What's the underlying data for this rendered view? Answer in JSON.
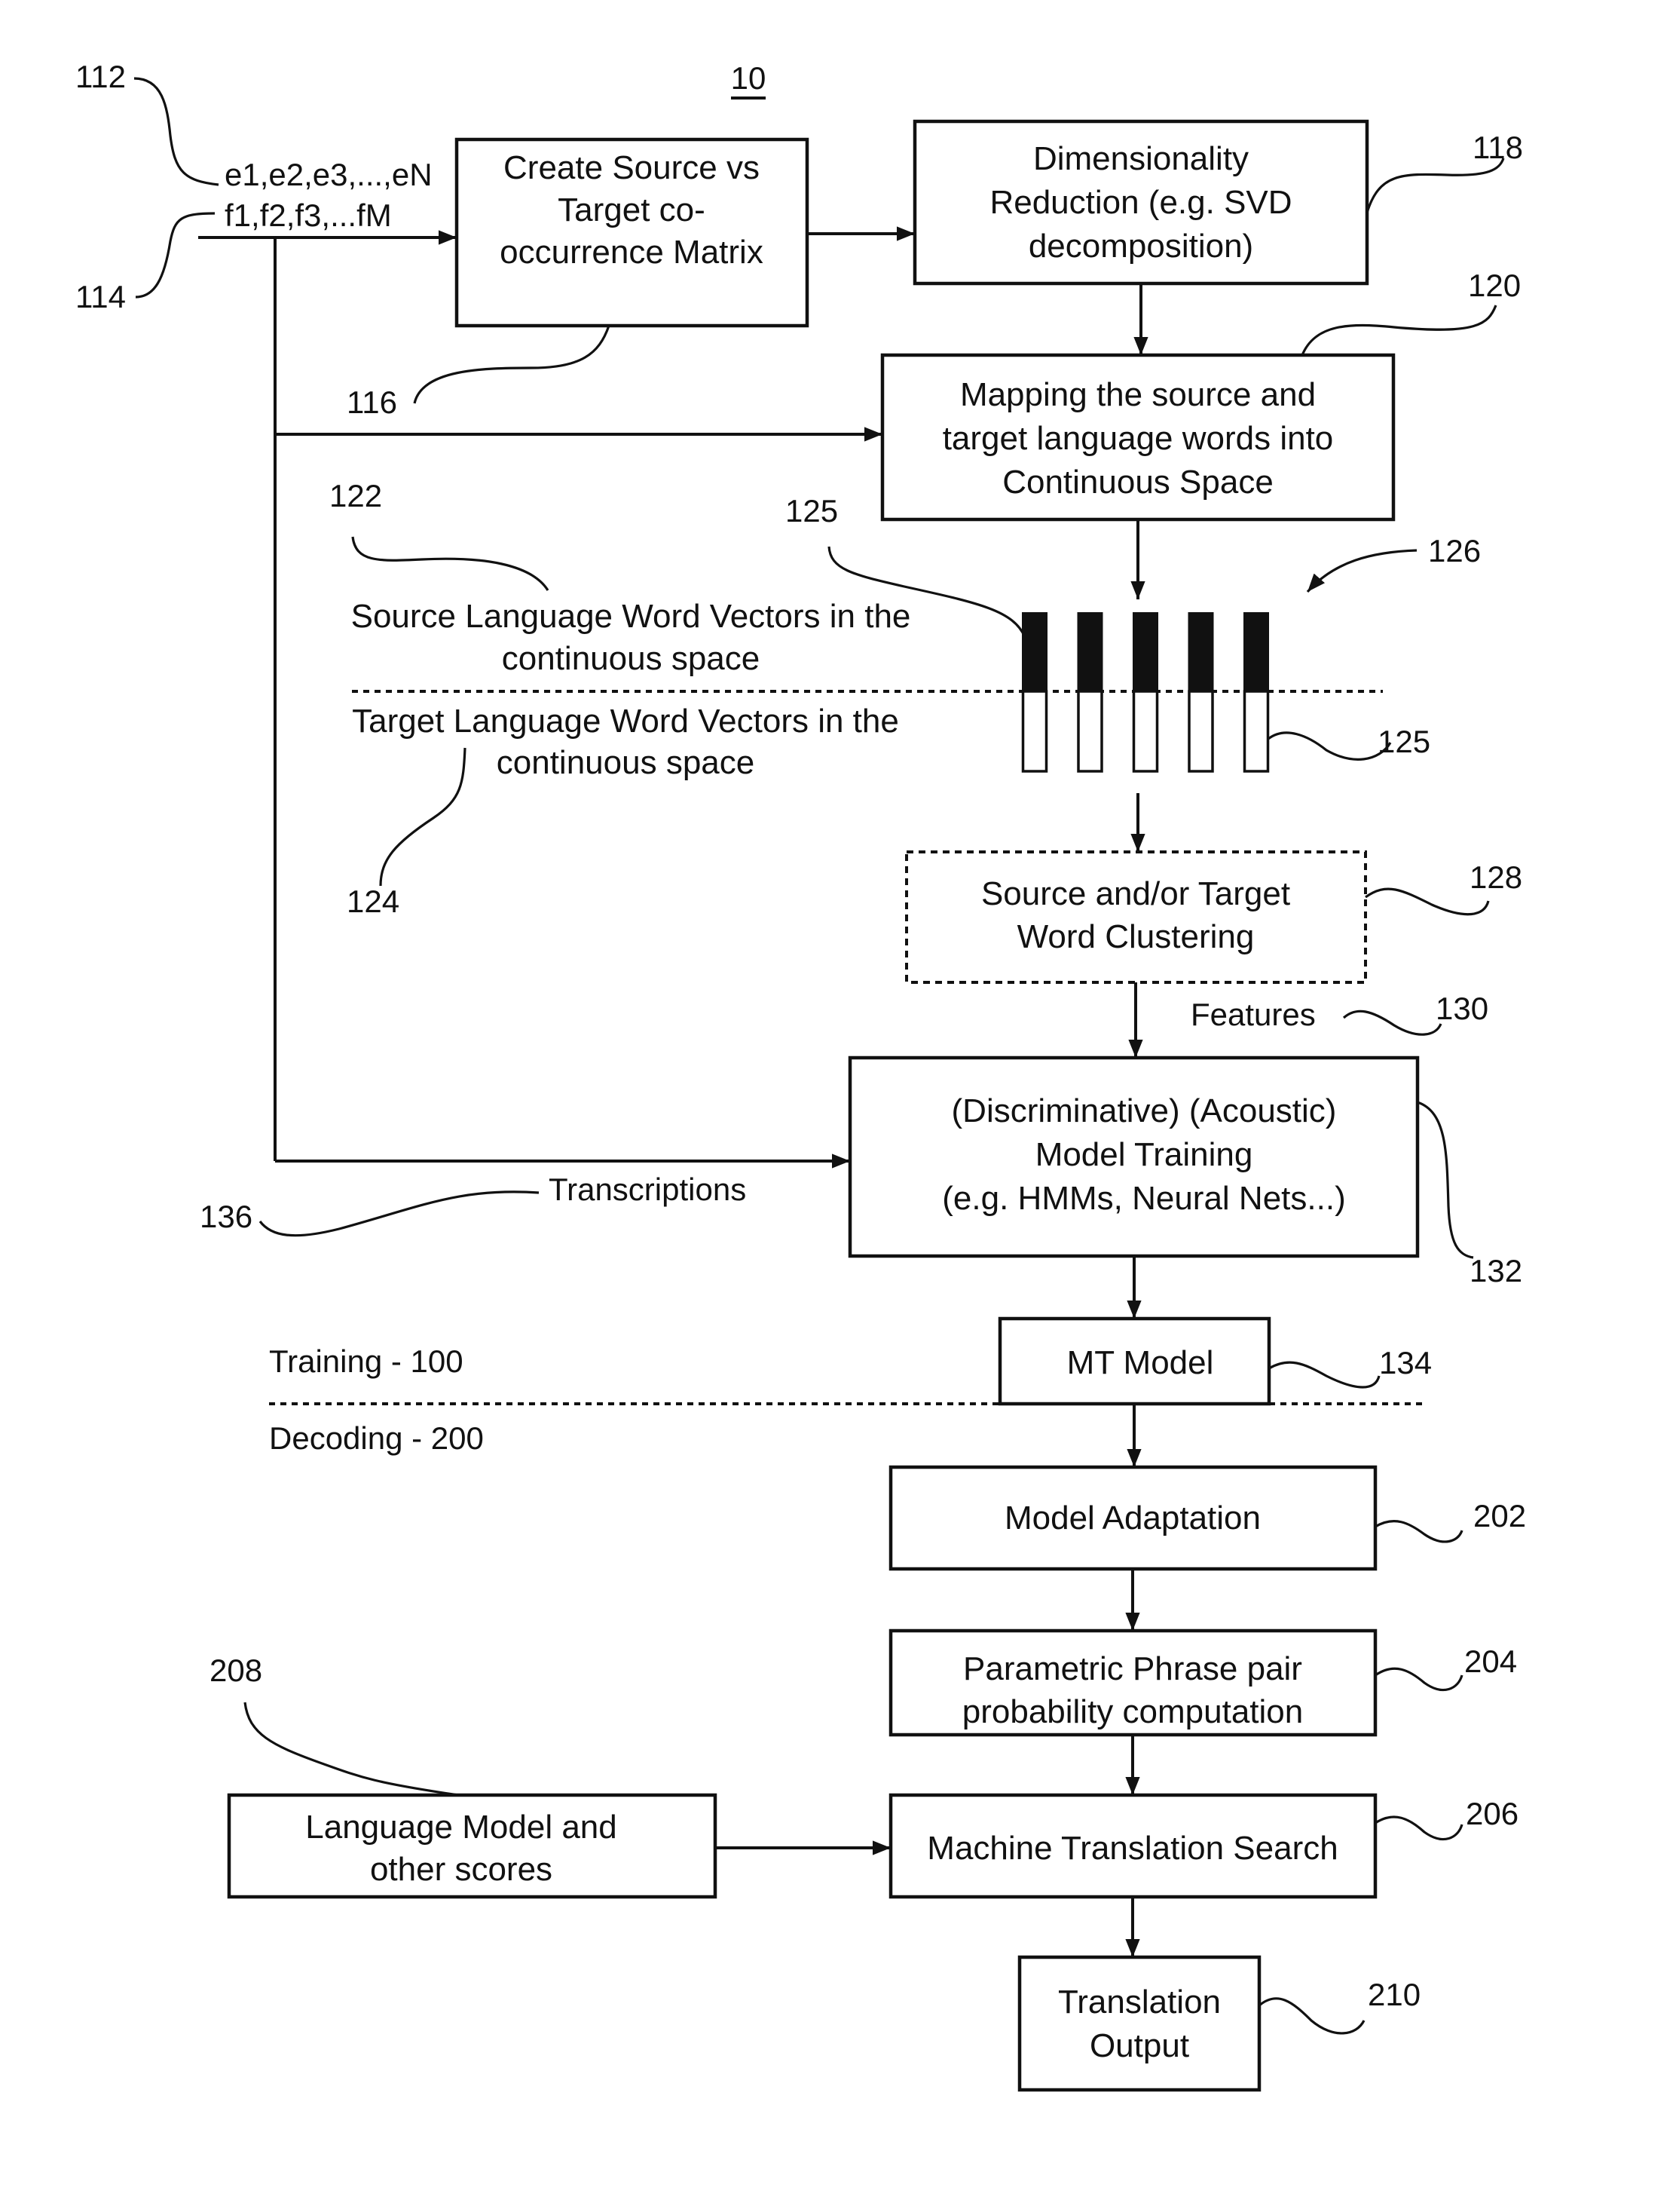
{
  "figure": {
    "number": "10",
    "phase_labels": {
      "training": "Training - 100",
      "decoding": "Decoding - 200"
    }
  },
  "inputs": {
    "source_sequence": {
      "text": "e1,e2,e3,...,eN",
      "ref": "112"
    },
    "target_sequence": {
      "text": "f1,f2,f3,...fM",
      "ref": "114"
    }
  },
  "boxes": {
    "cooccurrence": {
      "ref": "116",
      "lines": [
        "Create Source vs",
        "Target co-",
        "occurrence Matrix"
      ]
    },
    "dim_reduction": {
      "ref": "118",
      "lines": [
        "Dimensionality",
        "Reduction (e.g. SVD",
        "decomposition)"
      ]
    },
    "mapping": {
      "ref": "120",
      "lines": [
        "Mapping the source and",
        "target language words into",
        "Continuous Space"
      ]
    },
    "clustering": {
      "ref": "128",
      "style": "dashed",
      "lines": [
        "Source and/or Target",
        "Word Clustering"
      ]
    },
    "model_training": {
      "ref": "132",
      "lines": [
        "(Discriminative) (Acoustic)",
        "Model Training",
        "(e.g. HMMs, Neural Nets...)"
      ]
    },
    "mt_model": {
      "ref": "134",
      "lines": [
        "MT Model"
      ]
    },
    "model_adaptation": {
      "ref": "202",
      "lines": [
        "Model Adaptation"
      ]
    },
    "phrase_prob": {
      "ref": "204",
      "lines": [
        "Parametric Phrase pair",
        "probability computation"
      ]
    },
    "language_model": {
      "ref": "208",
      "lines": [
        "Language Model and",
        "other scores"
      ]
    },
    "mt_search": {
      "ref": "206",
      "lines": [
        "Machine Translation Search"
      ]
    },
    "translation_output": {
      "ref": "210",
      "lines": [
        "Translation",
        "Output"
      ]
    }
  },
  "vectors": {
    "group_ref": "126",
    "bar_ref_top": "125",
    "bar_ref_bottom": "125",
    "count": 5,
    "source_label": {
      "ref": "122",
      "lines": [
        "Source Language Word Vectors in the",
        "continuous space"
      ]
    },
    "target_label": {
      "ref": "124",
      "lines": [
        "Target Language Word Vectors in the",
        "continuous space"
      ]
    }
  },
  "edge_labels": {
    "features": {
      "text": "Features",
      "ref": "130"
    },
    "transcriptions": {
      "text": "Transcriptions",
      "ref": "136"
    }
  }
}
